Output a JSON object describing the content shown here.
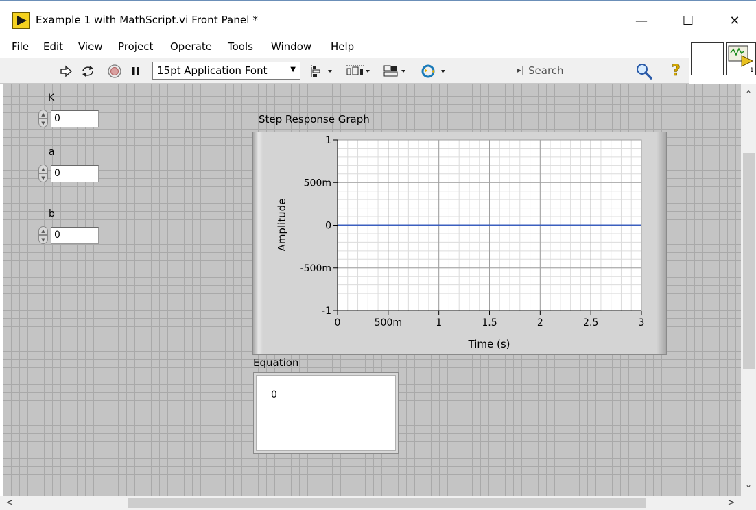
{
  "window": {
    "title": "Example 1 with MathScript.vi Front Panel *",
    "minimize_glyph": "—",
    "maximize_glyph": "☐",
    "close_glyph": "✕"
  },
  "menu": {
    "items": [
      "File",
      "Edit",
      "View",
      "Project",
      "Operate",
      "Tools",
      "Window",
      "Help"
    ]
  },
  "toolbar": {
    "font": "15pt Application Font",
    "search_placeholder": "Search",
    "icons": [
      "run-arrow-icon",
      "run-continuously-icon",
      "abort-icon",
      "pause-icon",
      "align-objects-icon",
      "distribute-objects-icon",
      "resize-objects-icon",
      "reorder-icon",
      "search-icon",
      "context-help-icon"
    ]
  },
  "controls": [
    {
      "label": "K",
      "value": "0"
    },
    {
      "label": "a",
      "value": "0"
    },
    {
      "label": "b",
      "value": "0"
    }
  ],
  "graph": {
    "label": "Step Response Graph"
  },
  "chart_data": {
    "type": "line",
    "title": "Step Response Graph",
    "xlabel": "Time (s)",
    "ylabel": "Amplitude",
    "xlim": [
      0,
      3
    ],
    "ylim": [
      -1,
      1
    ],
    "x_ticks": [
      "0",
      "500m",
      "1",
      "1.5",
      "2",
      "2.5",
      "3"
    ],
    "y_ticks": [
      "1",
      "500m",
      "0",
      "-500m",
      "-1"
    ],
    "grid": true,
    "series": [
      {
        "x": [
          0,
          3
        ],
        "y": [
          0,
          0
        ],
        "color": "#3b5fbf"
      }
    ]
  },
  "equation": {
    "label": "Equation",
    "value": "0"
  },
  "colors": {
    "panel_bg": "#c4c4c4",
    "plot_bg": "#ffffff",
    "trace": "#3b5fbf"
  }
}
